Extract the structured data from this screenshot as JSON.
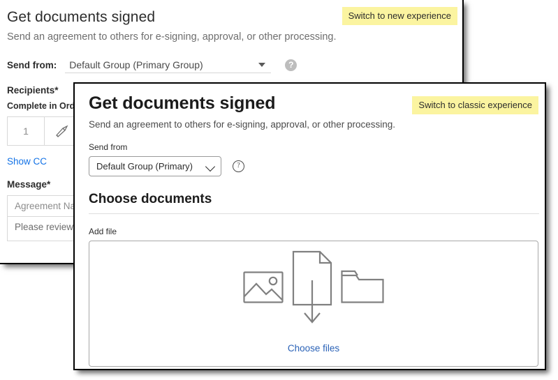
{
  "classic": {
    "title": "Get documents signed",
    "subtitle": "Send an agreement to others for e-signing, approval, or other processing.",
    "send_from": {
      "label": "Send from:",
      "value": "Default Group (Primary Group)",
      "help_icon": "question-mark-circle-icon",
      "caret_icon": "caret-down-icon"
    },
    "recipients": {
      "label": "Recipients",
      "required_mark": "*",
      "complete_in_order_label": "Complete in Order",
      "row_index": "1",
      "role_icon": "pen-signature-icon"
    },
    "show_cc_label": "Show CC",
    "message": {
      "label": "Message",
      "required_mark": "*",
      "name_placeholder": "Agreement Name",
      "body_placeholder": "Please review and sign this document."
    },
    "switch_button_label": "Switch to new experience"
  },
  "modal": {
    "title": "Get documents signed",
    "subtitle": "Send an agreement to others for e-signing, approval, or other processing.",
    "send_from": {
      "label": "Send from",
      "value": "Default Group (Primary)",
      "help_icon": "question-mark-circle-icon",
      "chevron_icon": "chevron-down-icon"
    },
    "choose_documents_heading": "Choose documents",
    "add_file_label": "Add file",
    "dropzone": {
      "image_icon": "image-picture-icon",
      "document_download_icon": "document-with-down-arrow-icon",
      "folder_icon": "folder-icon",
      "choose_files_label": "Choose files"
    },
    "switch_button_label": "Switch to classic experience"
  },
  "colors": {
    "highlight": "#fbf4a0",
    "link_blue": "#1473e6",
    "modal_link_blue": "#2a62b7",
    "icon_grey": "#808080",
    "border_black": "#000000"
  }
}
